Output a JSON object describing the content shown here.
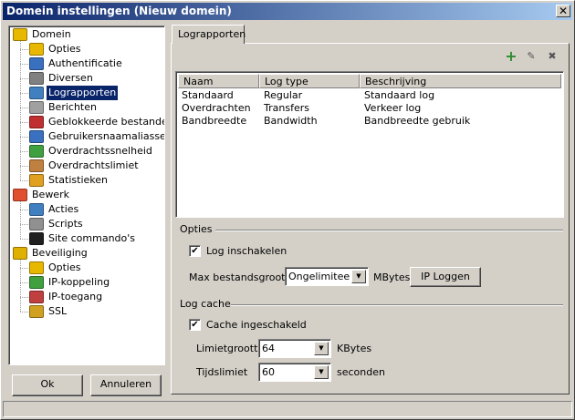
{
  "window": {
    "title": "Domein instellingen (Nieuw domein)",
    "close_glyph": "✕"
  },
  "tree": {
    "items": [
      {
        "label": "Domein",
        "icon": "domain-icon",
        "level": 0
      },
      {
        "label": "Opties",
        "icon": "options-icon",
        "level": 1
      },
      {
        "label": "Authentificatie",
        "icon": "user-key-icon",
        "level": 1
      },
      {
        "label": "Diversen",
        "icon": "device-icon",
        "level": 1
      },
      {
        "label": "Lograpporten",
        "icon": "log-report-icon",
        "level": 1,
        "selected": true
      },
      {
        "label": "Berichten",
        "icon": "message-icon",
        "level": 1
      },
      {
        "label": "Geblokkeerde bestanden",
        "icon": "blocked-files-icon",
        "level": 1
      },
      {
        "label": "Gebruikersnaamaliassen",
        "icon": "user-alias-icon",
        "level": 1
      },
      {
        "label": "Overdrachtssnelheid",
        "icon": "speedometer-icon",
        "level": 1
      },
      {
        "label": "Overdrachtslimiet",
        "icon": "transfer-limit-icon",
        "level": 1
      },
      {
        "label": "Statistieken",
        "icon": "statistics-icon",
        "level": 1
      },
      {
        "label": "Bewerk",
        "icon": "edit-icon",
        "level": 0
      },
      {
        "label": "Acties",
        "icon": "actions-icon",
        "level": 1
      },
      {
        "label": "Scripts",
        "icon": "scripts-icon",
        "level": 1
      },
      {
        "label": "Site commando's",
        "icon": "console-icon",
        "level": 1
      },
      {
        "label": "Beveiliging",
        "icon": "security-icon",
        "level": 0
      },
      {
        "label": "Opties",
        "icon": "options-icon",
        "level": 1
      },
      {
        "label": "IP-koppeling",
        "icon": "ip-binding-icon",
        "level": 1
      },
      {
        "label": "IP-toegang",
        "icon": "ip-access-icon",
        "level": 1
      },
      {
        "label": "SSL",
        "icon": "key-icon",
        "level": 1
      }
    ]
  },
  "buttons": {
    "ok": "Ok",
    "cancel": "Annuleren",
    "ip_log": "IP Loggen"
  },
  "tab": {
    "label": "Lograpporten"
  },
  "toolbar": {
    "add_glyph": "+",
    "edit_glyph": "✎",
    "delete_glyph": "✖",
    "add_color": "#2e8b2e"
  },
  "list": {
    "columns": [
      "Naam",
      "Log type",
      "Beschrijving"
    ],
    "rows": [
      [
        "Standaard",
        "Regular",
        "Standaard log"
      ],
      [
        "Overdrachten",
        "Transfers",
        "Verkeer log"
      ],
      [
        "Bandbreedte",
        "Bandwidth",
        "Bandbreedte gebruik"
      ]
    ]
  },
  "options": {
    "group_label": "Opties",
    "enable_log_label": "Log inschakelen",
    "enable_log_checked": true,
    "max_size_label": "Max bestandsgrootte",
    "max_size_value": "Ongelimiteerd",
    "max_size_unit": "MBytes"
  },
  "cache": {
    "group_label": "Log cache",
    "enabled_label": "Cache ingeschakeld",
    "enabled_checked": true,
    "limit_label": "Limietgrootte",
    "limit_value": "64",
    "limit_unit": "KBytes",
    "time_label": "Tijdslimiet",
    "time_value": "60",
    "time_unit": "seconden"
  },
  "check_glyph": "✔"
}
